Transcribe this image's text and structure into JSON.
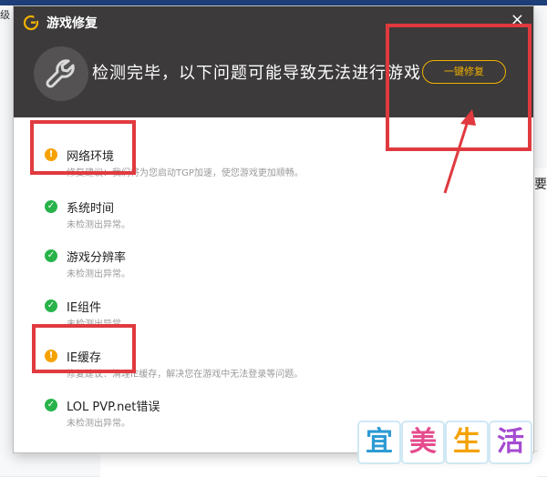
{
  "background": {
    "left_snippet": "级",
    "right_snippet": "不要"
  },
  "dialog": {
    "title": "游戏修复",
    "close_symbol": "×",
    "headline": "检测完毕，以下问题可能导致无法进行游戏",
    "fix_button_label": "一键修复",
    "colors": {
      "header_bg": "#3c3a3a",
      "accent": "#f2b100",
      "ok": "#28b34a",
      "warn": "#f5a200",
      "annotation_red": "#e03a3f"
    },
    "items": [
      {
        "title": "网络环境",
        "status": "warning",
        "detail": "修复建议：我们将为您启动TGP加速，使您游戏更加顺畅。"
      },
      {
        "title": "系统时间",
        "status": "ok",
        "detail": "未检测出异常。"
      },
      {
        "title": "游戏分辨率",
        "status": "ok",
        "detail": "未检测出异常。"
      },
      {
        "title": "IE组件",
        "status": "ok",
        "detail": "未检测出异常。"
      },
      {
        "title": "IE缓存",
        "status": "warning",
        "detail": "修复建议：清理IE缓存，解决您在游戏中无法登录等问题。"
      },
      {
        "title": "LOL PVP.net错误",
        "status": "ok",
        "detail": "未检测出异常。"
      }
    ]
  },
  "watermark": {
    "chars": [
      "宜",
      "美",
      "生",
      "活"
    ]
  }
}
